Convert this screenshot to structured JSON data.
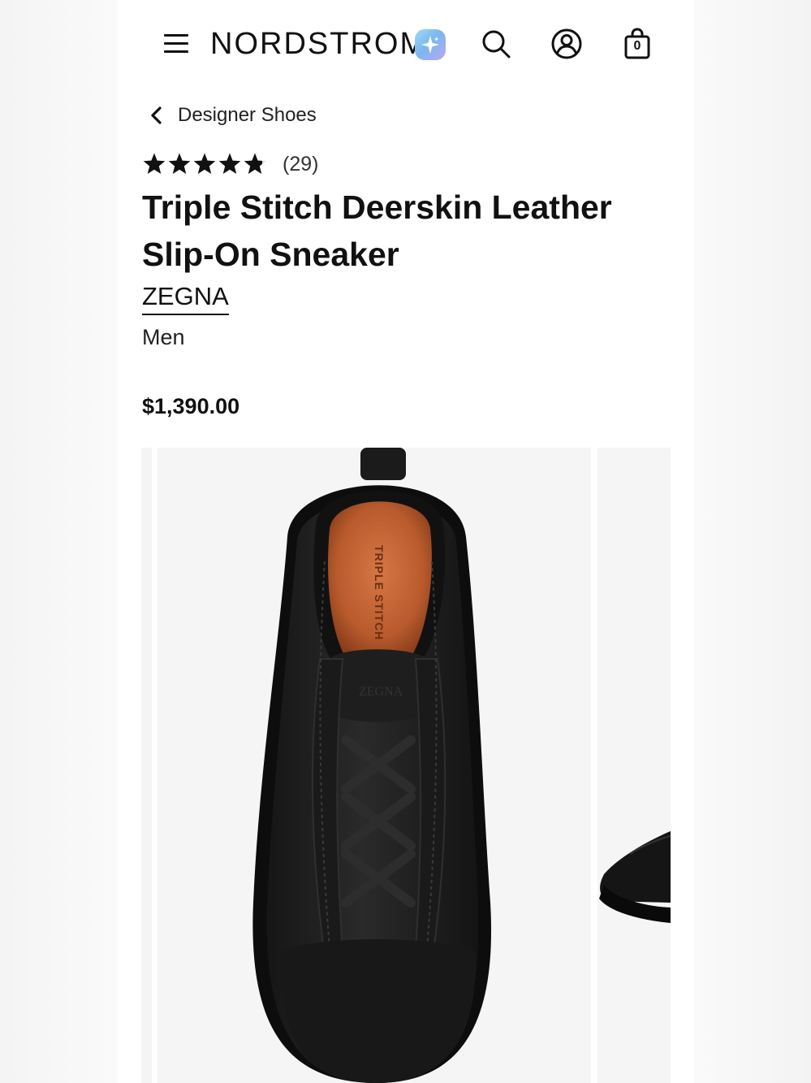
{
  "header": {
    "logo": "NORDSTROM",
    "bag_count": "0"
  },
  "icons": {
    "menu": "hamburger-menu-icon",
    "assistant": "sparkle-ai-icon",
    "search": "search-icon",
    "account": "account-icon",
    "bag": "shopping-bag-icon",
    "back": "chevron-left-icon",
    "star": "star-icon"
  },
  "breadcrumb": {
    "label": "Designer Shoes"
  },
  "product": {
    "rating": 4.8,
    "rating_max": 5,
    "review_count": "(29)",
    "title": "Triple Stitch Deerskin Leather Slip-On Sneaker",
    "brand": "ZEGNA",
    "gender": "Men",
    "price": "$1,390.00"
  },
  "gallery": {
    "image_alt": "Black slip-on sneaker top view",
    "insole_text": "TRIPLE STITCH",
    "tongue_text": "ZEGNA"
  },
  "colors": {
    "text": "#111111",
    "accent_gradient_start": "#9fd9f4",
    "accent_gradient_end": "#b9a7f3",
    "image_background": "#f5f5f5"
  }
}
